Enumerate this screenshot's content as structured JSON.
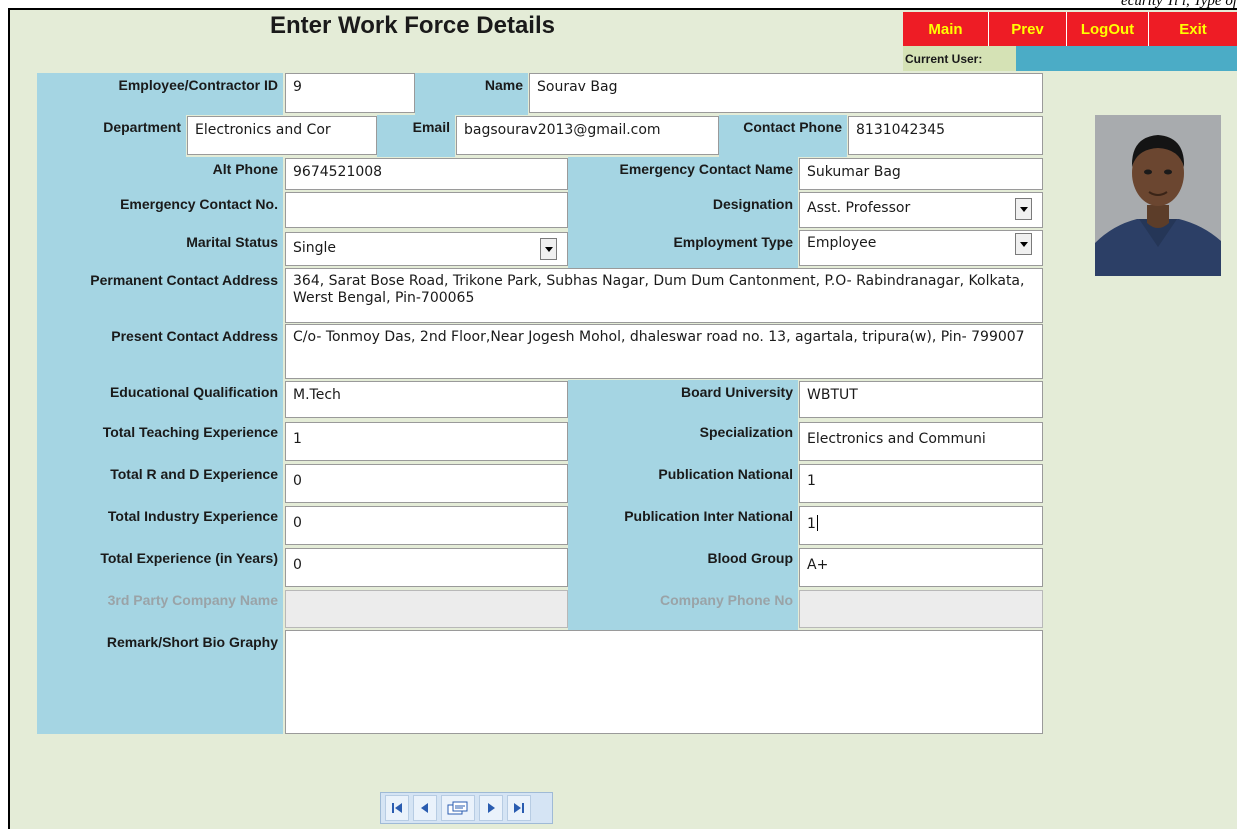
{
  "header": {
    "title": "Enter  Work Force Details",
    "corner_text": "ecurity Ti l, Type of",
    "buttons": {
      "main": "Main",
      "prev": "Prev",
      "logout": "LogOut",
      "exit": "Exit"
    },
    "current_user_label": "Current User:",
    "current_user_value": ""
  },
  "form": {
    "employee_id": {
      "label": "Employee/Contractor ID",
      "value": "9"
    },
    "name": {
      "label": "Name",
      "value": "Sourav Bag"
    },
    "department": {
      "label": "Department",
      "value": "Electronics and Cor"
    },
    "email": {
      "label": "Email",
      "value": "bagsourav2013@gmail.com"
    },
    "contact_phone": {
      "label": "Contact Phone",
      "value": "8131042345"
    },
    "alt_phone": {
      "label": "Alt Phone",
      "value": "9674521008"
    },
    "emergency_contact_name": {
      "label": "Emergency Contact Name",
      "value": "Sukumar Bag"
    },
    "emergency_contact_no": {
      "label": "Emergency Contact No.",
      "value": ""
    },
    "designation": {
      "label": "Designation",
      "value": "Asst. Professor"
    },
    "marital_status": {
      "label": "Marital Status",
      "value": "Single"
    },
    "employment_type": {
      "label": "Employment Type",
      "value": "Employee"
    },
    "permanent_address": {
      "label": "Permanent Contact Address",
      "value": "364, Sarat Bose Road, Trikone Park, Subhas Nagar, Dum Dum Cantonment, P.O- Rabindranagar, Kolkata, Werst Bengal, Pin-700065"
    },
    "present_address": {
      "label": "Present Contact Address",
      "value": "C/o- Tonmoy Das, 2nd Floor,Near Jogesh Mohol, dhaleswar road no. 13, agartala, tripura(w), Pin- 799007"
    },
    "educational_qualification": {
      "label": "Educational Qualification",
      "value": "M.Tech"
    },
    "board_university": {
      "label": "Board University",
      "value": "WBTUT"
    },
    "teaching_experience": {
      "label": "Total Teaching Experience",
      "value": "1"
    },
    "specialization": {
      "label": "Specialization",
      "value": "Electronics and Communi"
    },
    "rd_experience": {
      "label": "Total R and D Experience",
      "value": "0"
    },
    "publication_national": {
      "label": "Publication National",
      "value": "1"
    },
    "industry_experience": {
      "label": "Total Industry Experience",
      "value": "0"
    },
    "publication_international": {
      "label": "Publication Inter National",
      "value": "1"
    },
    "total_experience": {
      "label": "Total Experience (in Years)",
      "value": "0"
    },
    "blood_group": {
      "label": "Blood Group",
      "value": "A+"
    },
    "third_party_company": {
      "label": "3rd Party Company Name",
      "value": ""
    },
    "company_phone": {
      "label": "Company Phone No",
      "value": ""
    },
    "remark": {
      "label": "Remark/Short Bio Graphy",
      "value": ""
    }
  },
  "navigation": {
    "icons": [
      "first-record-icon",
      "previous-record-icon",
      "new-record-icon",
      "next-record-icon",
      "last-record-icon"
    ]
  },
  "colors": {
    "background": "#e4ecd7",
    "label_bg": "#a5d5e3",
    "button_bg": "#ee1c25",
    "button_text": "#ffff00",
    "user_bar": "#4bacc6"
  }
}
